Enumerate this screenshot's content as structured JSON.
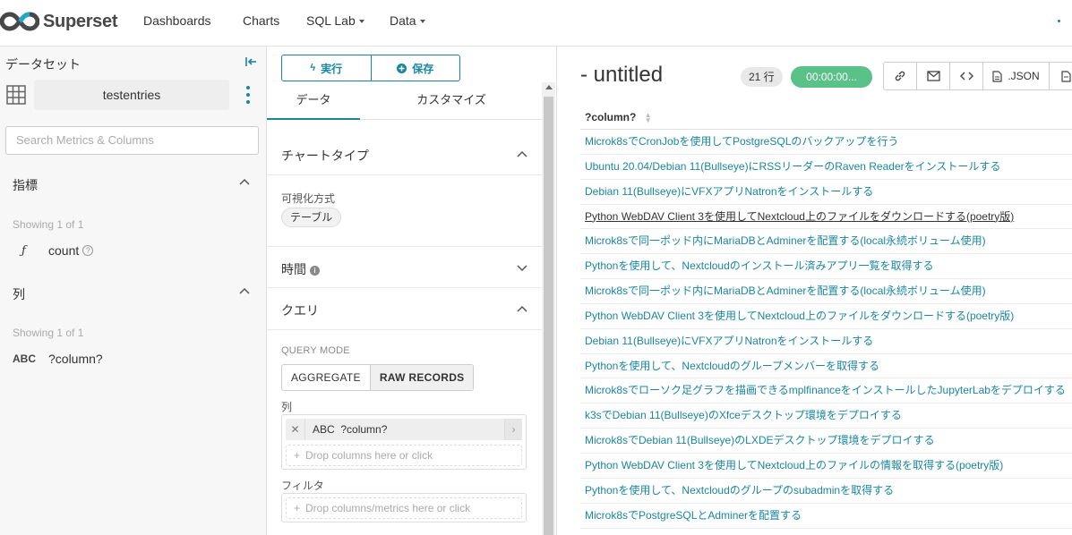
{
  "nav": {
    "brand": "Superset",
    "items": [
      {
        "label": "Dashboards",
        "dropdown": false
      },
      {
        "label": "Charts",
        "dropdown": false
      },
      {
        "label": "SQL Lab",
        "dropdown": true
      },
      {
        "label": "Data",
        "dropdown": true
      }
    ]
  },
  "dataset_panel": {
    "title": "データセット",
    "dataset_name": "testentries",
    "search_placeholder": "Search Metrics & Columns",
    "metrics": {
      "label": "指標",
      "showing": "Showing 1 of 1",
      "items": [
        {
          "icon": "function-icon",
          "glyph": "ƒ",
          "name": "count"
        }
      ]
    },
    "columns": {
      "label": "列",
      "showing": "Showing 1 of 1",
      "items": [
        {
          "icon": "string-type-icon",
          "glyph": "ABC",
          "name": "?column?"
        }
      ]
    }
  },
  "control_panel": {
    "run_label": "実行",
    "save_label": "保存",
    "tabs": [
      "データ",
      "カスタマイズ"
    ],
    "chart_type_section": "チャートタイプ",
    "viz_label": "可視化方式",
    "viz_value": "テーブル",
    "time_section": "時間",
    "query_section": "クエリ",
    "query_mode_label": "QUERY MODE",
    "query_modes": [
      "AGGREGATE",
      "RAW RECORDS"
    ],
    "active_query_mode": "RAW RECORDS",
    "columns_label": "列",
    "selected_column_type": "ABC",
    "selected_column": "?column?",
    "drop_columns_placeholder": "Drop columns here or click",
    "filters_label": "フィルタ",
    "drop_filters_placeholder": "Drop columns/metrics here or click"
  },
  "result_panel": {
    "title_prefix": "-",
    "title": "untitled",
    "row_count": "21 行",
    "timer": "00:00:00...",
    "actions": [
      {
        "icon": "link-icon"
      },
      {
        "icon": "mail-icon"
      },
      {
        "icon": "code-icon"
      },
      {
        "icon": "file-icon",
        "label": ".JSON"
      },
      {
        "icon": "file-icon"
      }
    ],
    "column_header": "?column?",
    "rows": [
      "Microk8sでCronJobを使用してPostgreSQLのバックアップを行う",
      "Ubuntu 20.04/Debian 11(Bullseye)にRSSリーダーのRaven Readerをインストールする",
      "Debian 11(Bullseye)にVFXアプリNatronをインストールする",
      "Python WebDAV Client 3を使用してNextcloud上のファイルをダウンロードする(poetry版)",
      "Microk8sで同一ポッド内にMariaDBとAdminerを配置する(local永続ボリューム使用)",
      "Pythonを使用して、Nextcloudのインストール済みアプリ一覧を取得する",
      "Microk8sで同一ポッド内にMariaDBとAdminerを配置する(local永続ボリューム使用)",
      "Python WebDAV Client 3を使用してNextcloud上のファイルをダウンロードする(poetry版)",
      "Debian 11(Bullseye)にVFXアプリNatronをインストールする",
      "Pythonを使用して、Nextcloudのグループメンバーを取得する",
      "Microk8sでローソク足グラフを描画できるmplfinanceをインストールしたJupyterLabをデプロイする",
      "k3sでDebian 11(Bullseye)のXfceデスクトップ環境をデプロイする",
      "Microk8sでDebian 11(Bullseye)のLXDEデスクトップ環境をデプロイする",
      "Python WebDAV Client 3を使用してNextcloud上のファイルの情報を取得する(poetry版)",
      "Pythonを使用して、Nextcloudのグループのsubadminを取得する",
      "Microk8sでPostgreSQLとAdminerを配置する"
    ],
    "hovered_row": 3
  },
  "colors": {
    "accent": "#1a85a0",
    "success": "#5ac189",
    "brand_logo": "#484848"
  }
}
